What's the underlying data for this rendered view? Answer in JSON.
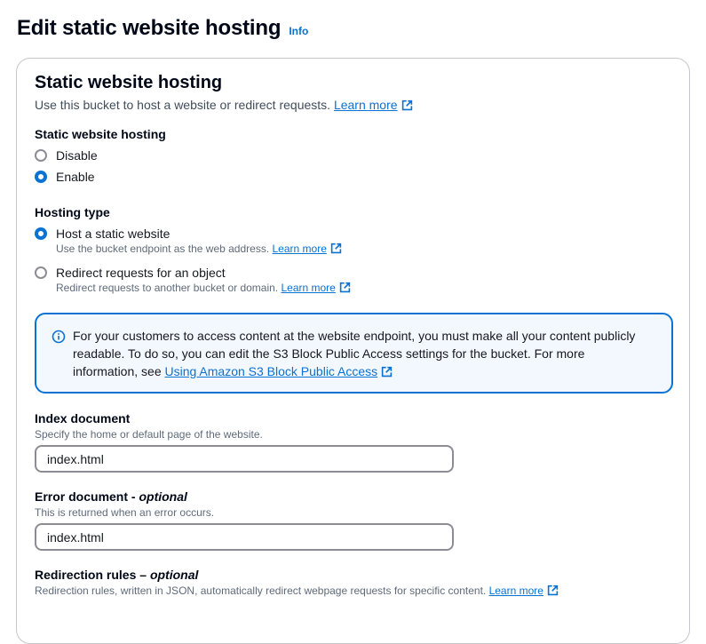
{
  "page": {
    "title": "Edit static website hosting",
    "info": "Info"
  },
  "section": {
    "title": "Static website hosting",
    "description": "Use this bucket to host a website or redirect requests.",
    "learn_more": "Learn more"
  },
  "hosting": {
    "label": "Static website hosting",
    "options": [
      {
        "label": "Disable",
        "checked": false
      },
      {
        "label": "Enable",
        "checked": true
      }
    ]
  },
  "hosting_type": {
    "label": "Hosting type",
    "options": [
      {
        "label": "Host a static website",
        "description": "Use the bucket endpoint as the web address.",
        "learn_more": "Learn more",
        "checked": true
      },
      {
        "label": "Redirect requests for an object",
        "description": "Redirect requests to another bucket or domain.",
        "learn_more": "Learn more",
        "checked": false
      }
    ]
  },
  "alert": {
    "text": "For your customers to access content at the website endpoint, you must make all your content publicly readable. To do so, you can edit the S3 Block Public Access settings for the bucket. For more information, see",
    "link": "Using Amazon S3 Block Public Access"
  },
  "index_document": {
    "label": "Index document",
    "description": "Specify the home or default page of the website.",
    "value": "index.html"
  },
  "error_document": {
    "label": "Error document",
    "optional": "optional",
    "description": "This is returned when an error occurs.",
    "value": "index.html"
  },
  "redirection_rules": {
    "label": "Redirection rules",
    "optional": "optional",
    "description": "Redirection rules, written in JSON, automatically redirect webpage requests for specific content.",
    "learn_more": "Learn more"
  },
  "colors": {
    "link": "#0972d3",
    "alert_bg": "#f2f8fd",
    "border": "#8c8c94"
  },
  "icons": {
    "external": "external-link-icon",
    "info": "info-circle-icon"
  }
}
